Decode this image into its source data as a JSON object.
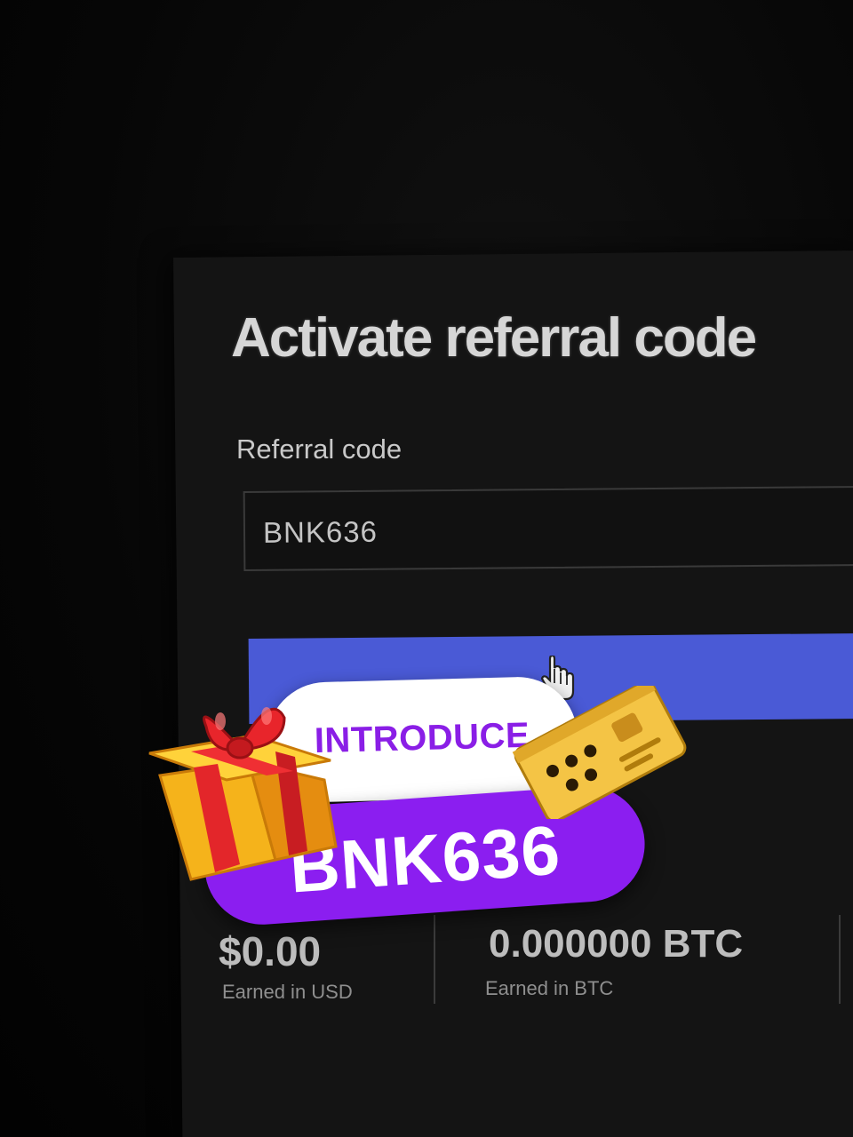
{
  "referral_form": {
    "title": "Activate referral code",
    "field_label": "Referral code",
    "field_value": "BNK636",
    "submit_label": ""
  },
  "promo": {
    "intro_label": "INTRODUCE",
    "code": "BNK636",
    "icons": [
      "gift-icon",
      "card-icon",
      "hand-cursor-icon"
    ]
  },
  "stats": [
    {
      "value": "$0.00",
      "caption": "Earned in USD"
    },
    {
      "value": "0.000000 BTC",
      "caption": "Earned in BTC"
    }
  ],
  "colors": {
    "button": "#4a5ad6",
    "promo_purple": "#8b1ef0",
    "intro_text": "#8a1ee6"
  }
}
